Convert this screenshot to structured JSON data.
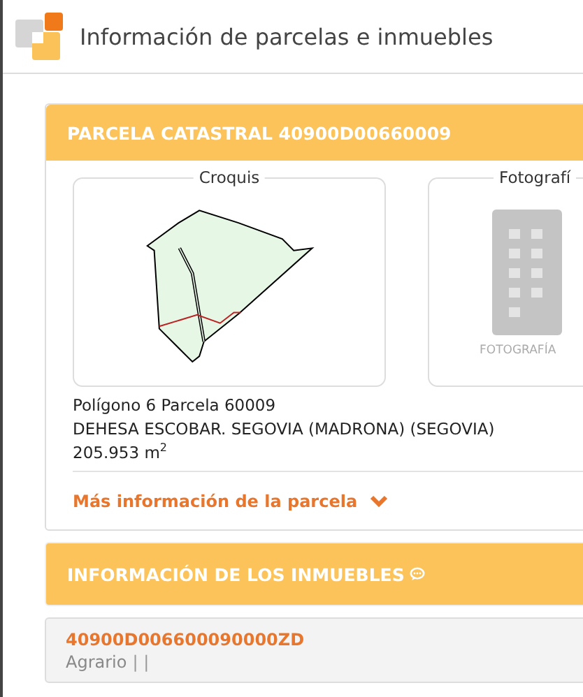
{
  "window": {
    "title": "Información de parcelas e inmuebles"
  },
  "parcel": {
    "header": "PARCELA CATASTRAL 40900D00660009",
    "sketch": {
      "legend": "Croquis"
    },
    "photo": {
      "legend": "Fotografí",
      "caption": "FOTOGRAFÍA"
    },
    "lines": [
      "Polígono 6 Parcela 60009",
      "DEHESA ESCOBAR. SEGOVIA (MADRONA) (SEGOVIA)",
      "205.953 m$^{2}$"
    ],
    "more_link": {
      "label": "Más información de la parcela",
      "expanded": false
    }
  },
  "properties": {
    "header": "INFORMACIÓN DE LOS INMUEBLES",
    "items": [
      {
        "reference": "40900D006600090000ZD",
        "use": "Agrario",
        "separators": "| |"
      }
    ]
  }
}
